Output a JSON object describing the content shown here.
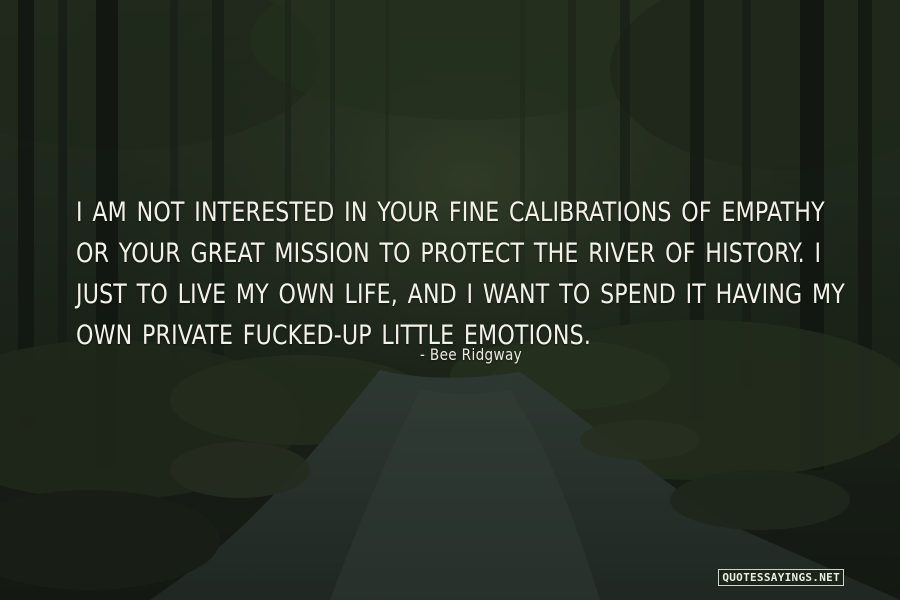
{
  "quote": {
    "lines": [
      "I am not interested in your fine calibrations of empathy",
      "or your great mission to protect the river of history. I",
      "just to live my own life, and I want to spend it having my",
      "own private fucked-up little emotions."
    ],
    "author": "- Bee Ridgway"
  },
  "watermark": "QUOTESSAYINGS.NET",
  "colors": {
    "text": "#f3f1e8",
    "background": "#1e261c",
    "foliage": "#3a4a2c",
    "water": "#2f3a36"
  }
}
